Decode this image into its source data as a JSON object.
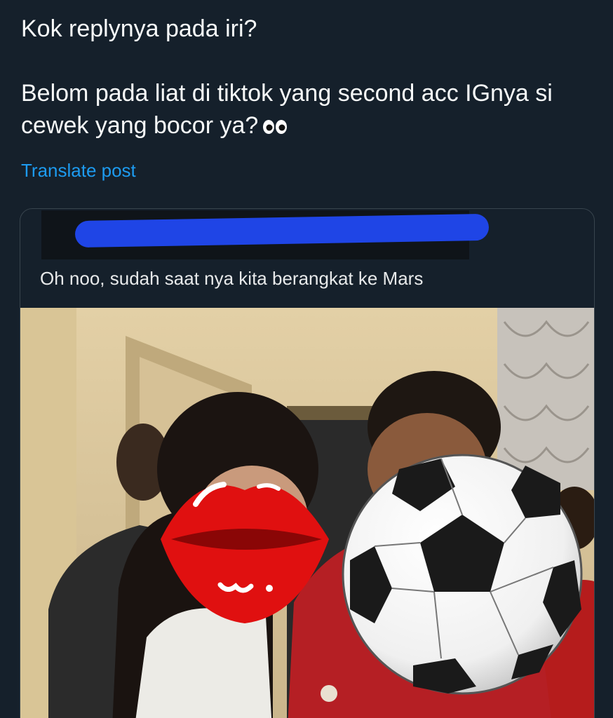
{
  "post": {
    "line1": "Kok replynya pada iri?",
    "line2": "Belom pada liat di tiktok yang second acc IGnya si cewek yang bocor ya?",
    "emoji": "eyes-emoji",
    "translate_label": "Translate post"
  },
  "quote": {
    "text": "Oh noo, sudah saat nya kita berangkat ke Mars"
  },
  "colors": {
    "background": "#15202b",
    "link": "#1d9bf0",
    "redact": "#1f45e6",
    "lips": "#e01010"
  }
}
